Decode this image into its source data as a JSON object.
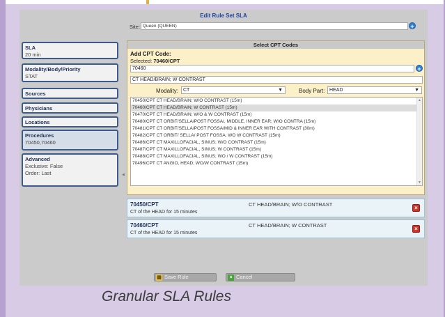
{
  "dialog": {
    "title": "Edit Rule Set SLA"
  },
  "site": {
    "label": "Site",
    "value": "Queen (QUEEN)"
  },
  "sidebar": {
    "items": [
      {
        "label": "SLA",
        "sub": [
          "20 min"
        ]
      },
      {
        "label": "Modality/Body/Priority",
        "sub": [
          "STAT"
        ]
      },
      {
        "label": "Sources",
        "sub": []
      },
      {
        "label": "Physicians",
        "sub": []
      },
      {
        "label": "Locations",
        "sub": []
      },
      {
        "label": "Procedures",
        "sub": [
          "70450,70460"
        ]
      },
      {
        "label": "Advanced",
        "sub": [
          "Exclusive: False",
          "Order: Last"
        ]
      }
    ]
  },
  "cpt": {
    "section_title": "Select CPT Codes",
    "add_label": "Add CPT Code:",
    "selected_prefix": "Selected:",
    "selected_value": "70460/CPT",
    "code_input": "70460",
    "description": "CT HEAD/BRAIN; W CONTRAST",
    "modality_label": "Modality:",
    "modality_value": "CT",
    "bodypart_label": "Body Part:",
    "bodypart_value": "HEAD",
    "list": [
      "70450/CPT CT HEAD/BRAIN; W/O CONTRAST (15m)",
      "70460/CPT CT HEAD/BRAIN; W CONTRAST (15m)",
      "70470/CPT CT HEAD/BRAIN; W/O & W CONTRAST (15m)",
      "70480/CPT CT ORBIT/SELLA/POST FOSSA/, MIDDLE, INNER EAR; W/O CONTRA (15m)",
      "70481/CPT CT ORBIT/SELLA/POST FOSSA/MID & INNER EAR WITH CONTRAST (30m)",
      "70482/CPT CT ORBIT/ SELLA/ POST FOSSA; WO W CONTRAST (15m)",
      "70486/CPT CT MAXILLOFACIAL, SINUS; W/O CONTRAST (15m)",
      "70487/CPT CT MAXILLOFACIAL, SINUS; W CONTRAST (15m)",
      "70488/CPT CT MAXILLOFACIAL, SINUS; WO / W CONTRAST (15m)",
      "70496/CPT CT ANGIO, HEAD; WO/W CONTRAST (15m)"
    ],
    "selected_index": 1
  },
  "chosen": [
    {
      "code": "70450/CPT",
      "desc": "CT HEAD/BRAIN; W/O CONTRAST",
      "sub": "CT of the HEAD for 15 minutes"
    },
    {
      "code": "70460/CPT",
      "desc": "CT HEAD/BRAIN; W CONTRAST",
      "sub": "CT of the HEAD for 15 minutes"
    }
  ],
  "buttons": {
    "save": "Save Rule",
    "cancel": "Cancel"
  },
  "caption": "Granular SLA Rules",
  "colors": {
    "title": "#1b3ea3",
    "sidebar_border": "#3d5a8c",
    "panel_bg": "#cbcbcb",
    "page_bg": "#d7cbe6"
  }
}
